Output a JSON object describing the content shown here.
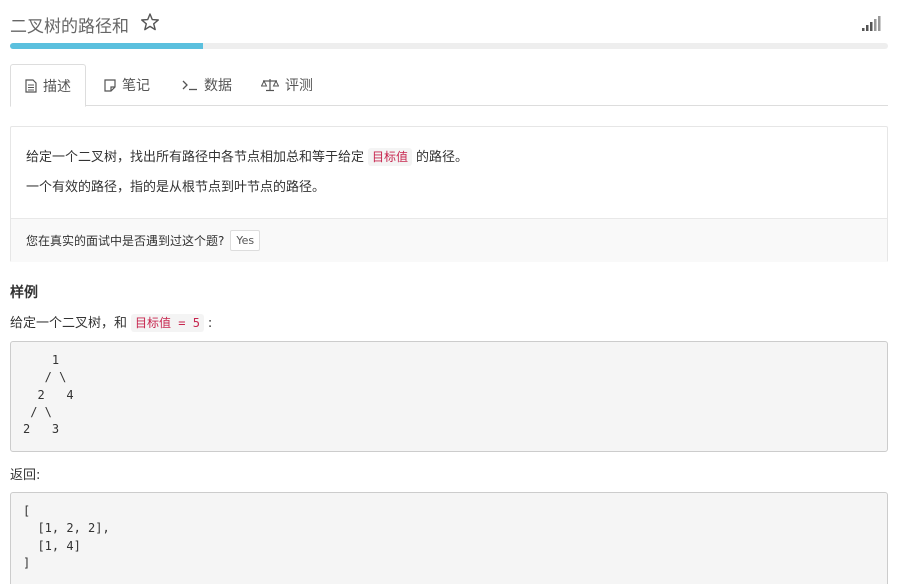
{
  "header": {
    "title": "二叉树的路径和",
    "star_icon": "star-icon",
    "signal_icon": "difficulty-signal-icon"
  },
  "progress": {
    "value_fraction": 0.22,
    "color": "#5bc0de"
  },
  "tabs": [
    {
      "label": "描述",
      "icon": "document-icon",
      "active": true
    },
    {
      "label": "笔记",
      "icon": "note-icon",
      "active": false
    },
    {
      "label": "数据",
      "icon": "terminal-icon",
      "active": false
    },
    {
      "label": "评测",
      "icon": "scale-icon",
      "active": false
    }
  ],
  "description": {
    "line1_before": "给定一个二叉树，找出所有路径中各节点相加总和等于给定",
    "line1_code": "目标值",
    "line1_after": "的路径。",
    "line2": "一个有效的路径，指的是从根节点到叶节点的路径。"
  },
  "interview": {
    "question": "您在真实的面试中是否遇到过这个题?",
    "yes_label": "Yes"
  },
  "example": {
    "heading": "样例",
    "intro_before": "给定一个二叉树，和",
    "intro_code": "目标值 = 5",
    "intro_after": ":",
    "tree_code": "    1\n   / \\\n  2   4\n / \\\n2   3",
    "return_label": "返回:",
    "result_code": "[\n  [1, 2, 2],\n  [1, 4]\n]"
  },
  "colors": {
    "accent": "#5bc0de",
    "inline_code_text": "#c7254e"
  }
}
